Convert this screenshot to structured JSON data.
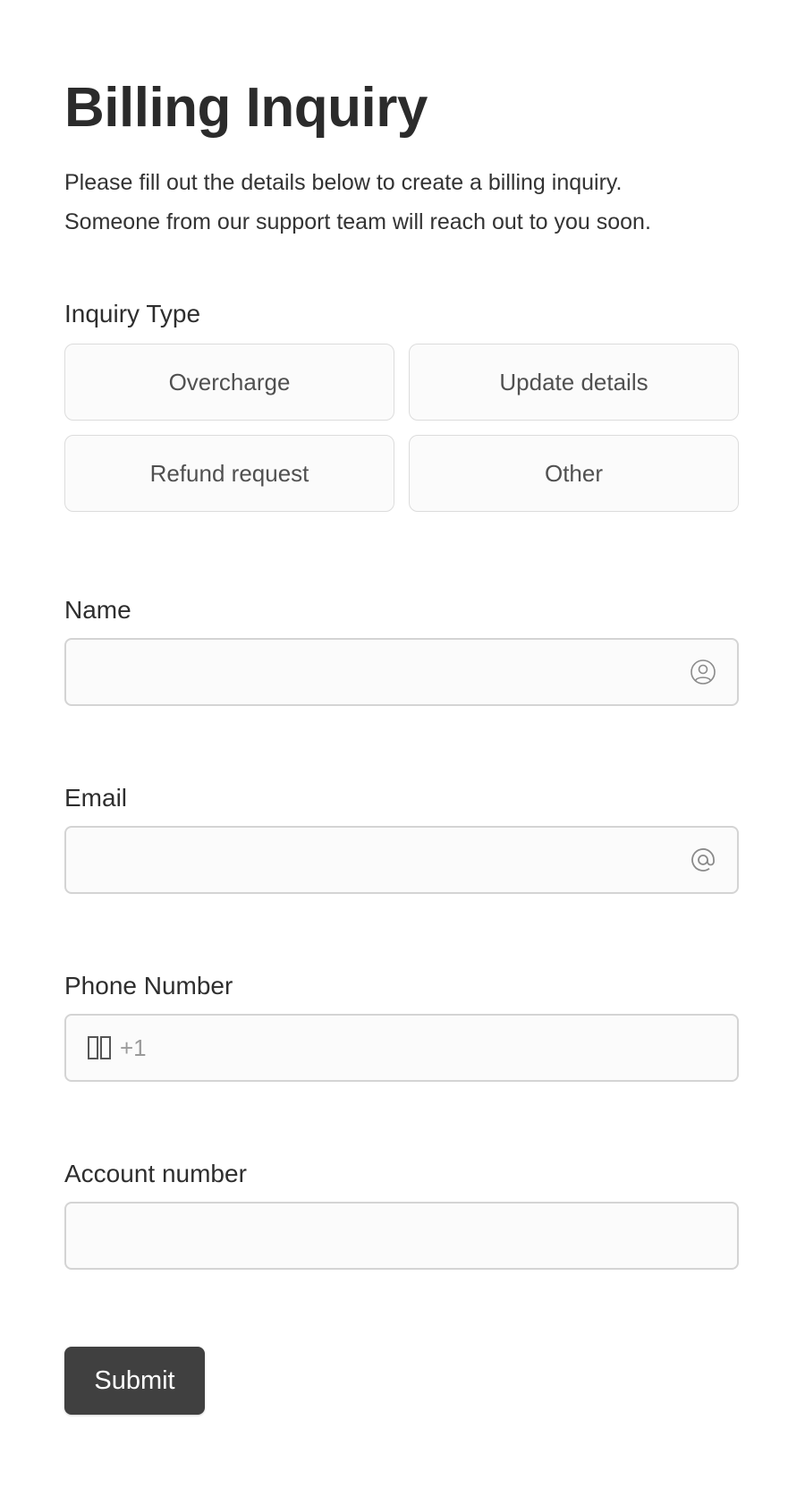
{
  "header": {
    "title": "Billing Inquiry",
    "description_line1": "Please fill out the details below to create a billing inquiry.",
    "description_line2": "Someone from our support team will reach out to you soon."
  },
  "inquiry_type": {
    "label": "Inquiry Type",
    "options": [
      "Overcharge",
      "Update details",
      "Refund request",
      "Other"
    ]
  },
  "fields": {
    "name": {
      "label": "Name",
      "value": "",
      "placeholder": "",
      "icon": "user-circle-icon"
    },
    "email": {
      "label": "Email",
      "value": "",
      "placeholder": "",
      "icon": "at-sign-icon"
    },
    "phone": {
      "label": "Phone Number",
      "value": "",
      "placeholder": "+1",
      "icon": "flag-icon"
    },
    "account": {
      "label": "Account number",
      "value": "",
      "placeholder": ""
    }
  },
  "submit": {
    "label": "Submit"
  },
  "colors": {
    "button_bg": "#404040",
    "text": "#2e2e2e",
    "border": "#d4d4d4"
  }
}
